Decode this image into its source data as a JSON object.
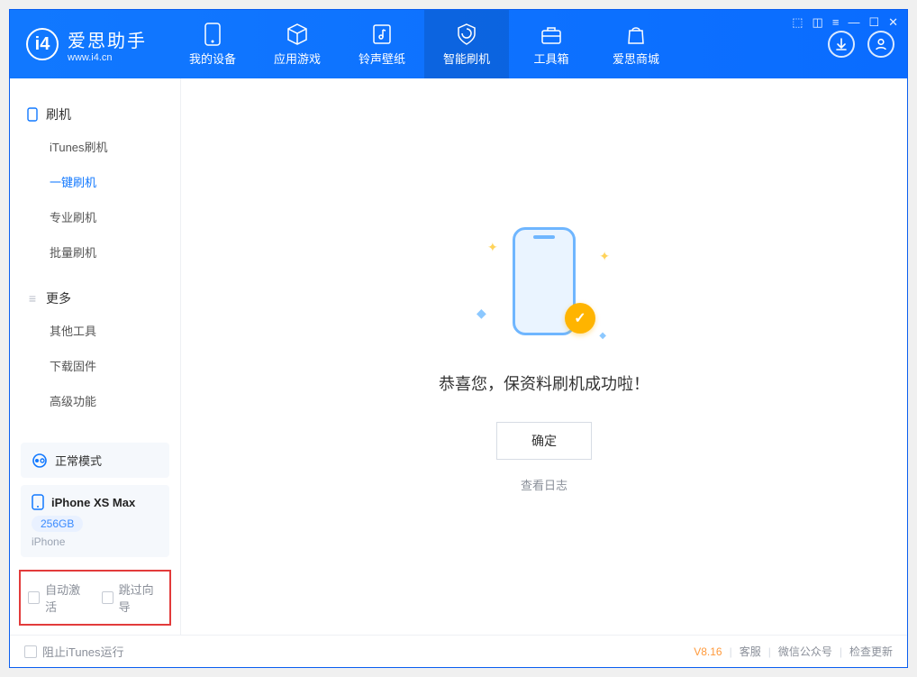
{
  "brand": {
    "name": "爱思助手",
    "url": "www.i4.cn"
  },
  "tabs": {
    "device": "我的设备",
    "apps": "应用游戏",
    "ring": "铃声壁纸",
    "flash": "智能刷机",
    "tools": "工具箱",
    "store": "爱思商城"
  },
  "sidebar": {
    "group1": "刷机",
    "items1": {
      "itunes": "iTunes刷机",
      "oneclick": "一键刷机",
      "pro": "专业刷机",
      "batch": "批量刷机"
    },
    "group2": "更多",
    "items2": {
      "other": "其他工具",
      "firmware": "下载固件",
      "adv": "高级功能"
    }
  },
  "mode": {
    "label": "正常模式"
  },
  "device": {
    "name": "iPhone XS Max",
    "capacity": "256GB",
    "type": "iPhone"
  },
  "options": {
    "auto_activate": "自动激活",
    "skip_guide": "跳过向导"
  },
  "main": {
    "success": "恭喜您，保资料刷机成功啦！",
    "ok": "确定",
    "view_log": "查看日志"
  },
  "footer": {
    "block_itunes": "阻止iTunes运行",
    "version": "V8.16",
    "kefu": "客服",
    "wechat": "微信公众号",
    "update": "检查更新"
  }
}
